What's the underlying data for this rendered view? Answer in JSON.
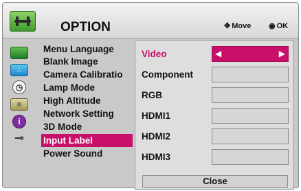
{
  "header": {
    "title": "OPTION",
    "move_hint": "Move",
    "ok_hint": "OK"
  },
  "menu": {
    "items": [
      {
        "label": "Menu Language"
      },
      {
        "label": "Blank Image"
      },
      {
        "label": "Camera Calibratio"
      },
      {
        "label": "Lamp Mode"
      },
      {
        "label": "High Altitude"
      },
      {
        "label": "Network Setting"
      },
      {
        "label": "3D Mode"
      },
      {
        "label": "Input Label",
        "selected": true
      },
      {
        "label": "Power Sound"
      }
    ]
  },
  "side_icons": [
    "monitor-icon",
    "picture-icon",
    "clock-icon",
    "option-icon",
    "info-icon",
    "cable-icon"
  ],
  "popup": {
    "rows": [
      {
        "label": "Video",
        "selected": true
      },
      {
        "label": "Component"
      },
      {
        "label": "RGB"
      },
      {
        "label": "HDMI1"
      },
      {
        "label": "HDMI2"
      },
      {
        "label": "HDMI3"
      }
    ],
    "close_label": "Close"
  },
  "colors": {
    "accent": "#c8106a",
    "background": "#c9c9c9"
  }
}
